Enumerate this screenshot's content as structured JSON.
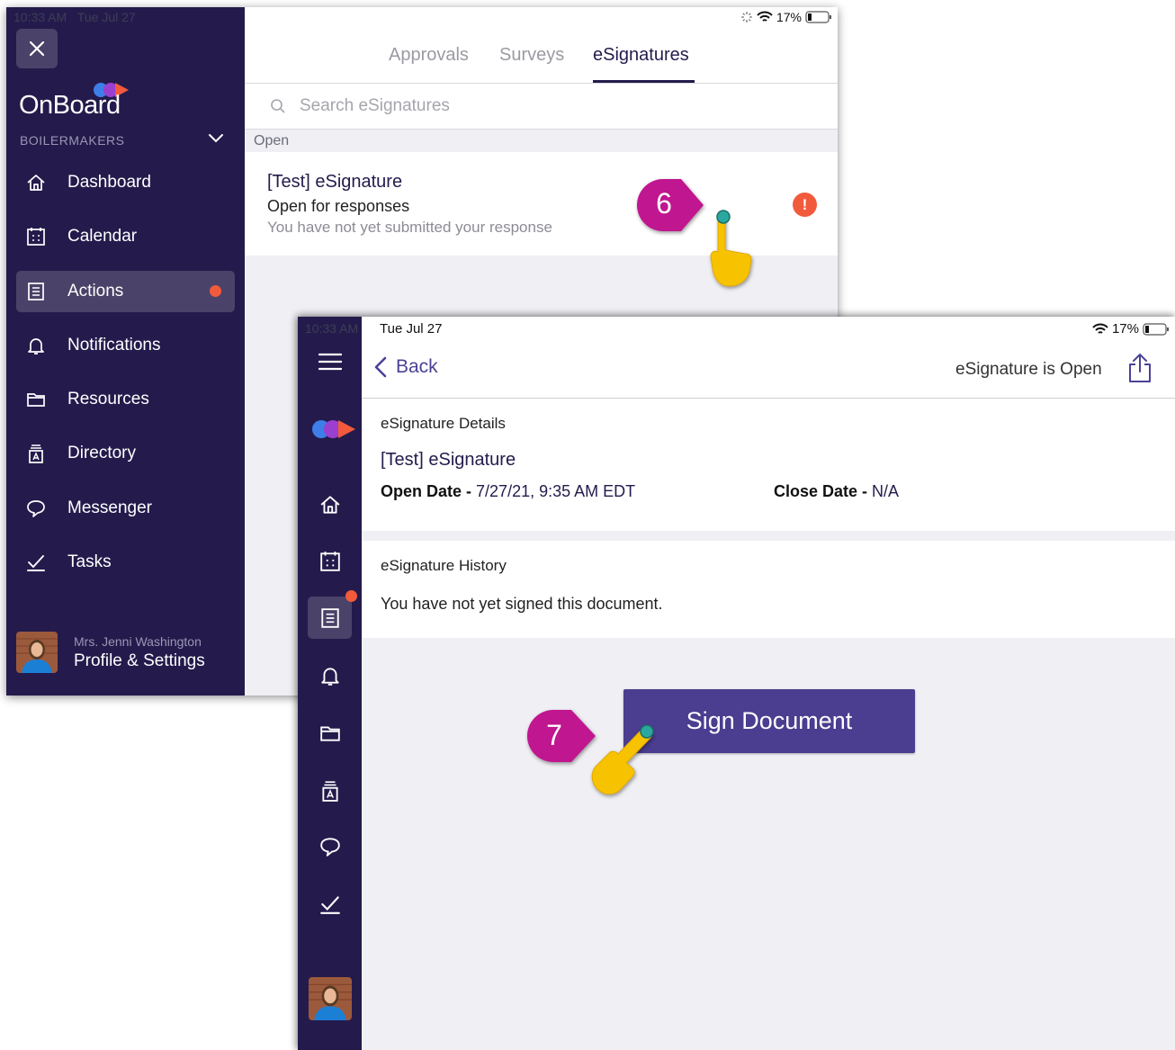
{
  "screen1": {
    "status": {
      "time": "10:33 AM",
      "date": "Tue Jul 27",
      "battery": "17%"
    },
    "sidebar": {
      "logo": "OnBoard",
      "organization": "BOILERMAKERS",
      "items": [
        {
          "label": "Dashboard",
          "icon": "home-icon"
        },
        {
          "label": "Calendar",
          "icon": "calendar-icon"
        },
        {
          "label": "Actions",
          "icon": "actions-icon",
          "active": true,
          "badge": true
        },
        {
          "label": "Notifications",
          "icon": "bell-icon"
        },
        {
          "label": "Resources",
          "icon": "folder-icon"
        },
        {
          "label": "Directory",
          "icon": "directory-icon"
        },
        {
          "label": "Messenger",
          "icon": "chat-icon"
        },
        {
          "label": "Tasks",
          "icon": "checkmark-icon"
        }
      ],
      "profile": {
        "name": "Mrs. Jenni Washington",
        "link": "Profile & Settings"
      }
    },
    "tabs": [
      "Approvals",
      "Surveys",
      "eSignatures"
    ],
    "active_tab": "eSignatures",
    "search": {
      "placeholder": "Search eSignatures"
    },
    "section": "Open",
    "item": {
      "title": "[Test] eSignature",
      "status": "Open for responses",
      "subtitle": "You have not yet submitted your response",
      "alert": "!"
    }
  },
  "screen2": {
    "status": {
      "time": "10:33 AM",
      "date": "Tue Jul 27",
      "battery": "17%"
    },
    "header": {
      "back": "Back",
      "status_text": "eSignature is Open"
    },
    "details": {
      "heading": "eSignature Details",
      "title": "[Test] eSignature",
      "open_label": "Open Date -",
      "open_value": "7/27/21, 9:35 AM EDT",
      "close_label": "Close Date -",
      "close_value": "N/A"
    },
    "history": {
      "heading": "eSignature History",
      "text": "You have not yet signed this document."
    },
    "sign_button": "Sign Document"
  },
  "callouts": {
    "step6": "6",
    "step7": "7"
  },
  "colors": {
    "sidebar": "#241b4c",
    "accent": "#4b3d8f",
    "badge": "#f25a3c",
    "callout": "#c0188f",
    "pointer": "#f7c300"
  }
}
